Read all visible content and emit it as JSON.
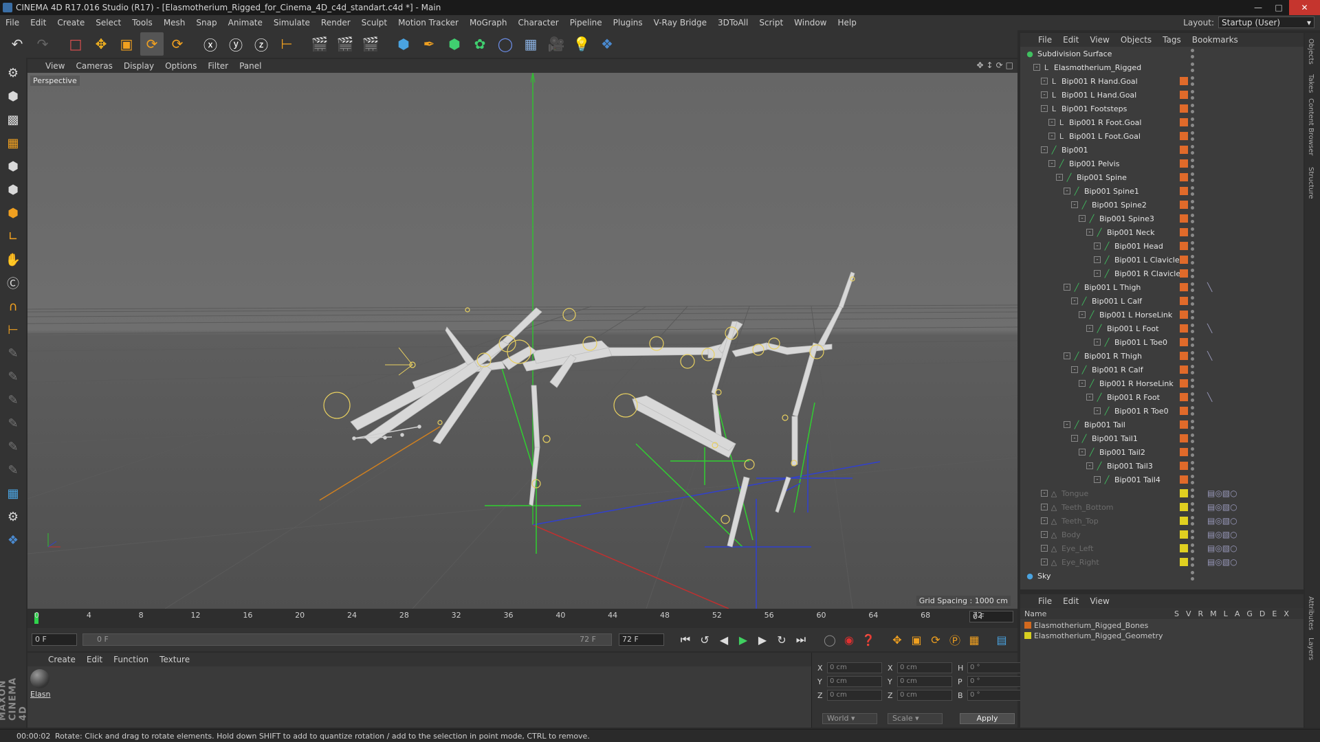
{
  "window": {
    "title": "CINEMA 4D R17.016 Studio (R17) - [Elasmotherium_Rigged_for_Cinema_4D_c4d_standart.c4d *] - Main"
  },
  "menubar": {
    "items": [
      "File",
      "Edit",
      "Create",
      "Select",
      "Tools",
      "Mesh",
      "Snap",
      "Animate",
      "Simulate",
      "Render",
      "Sculpt",
      "Motion Tracker",
      "MoGraph",
      "Character",
      "Pipeline",
      "Plugins",
      "V-Ray Bridge",
      "3DToAll",
      "Script",
      "Window",
      "Help"
    ],
    "layout_label": "Layout:",
    "layout_value": "Startup (User)"
  },
  "viewport": {
    "menu": [
      "View",
      "Cameras",
      "Display",
      "Options",
      "Filter",
      "Panel"
    ],
    "camera_label": "Perspective",
    "grid_spacing": "Grid Spacing : 1000 cm"
  },
  "timeline": {
    "ticks": [
      "0",
      "4",
      "8",
      "12",
      "16",
      "20",
      "24",
      "28",
      "32",
      "36",
      "40",
      "44",
      "48",
      "52",
      "56",
      "60",
      "64",
      "68",
      "72"
    ],
    "current_frame": "0 F"
  },
  "transport": {
    "start_field": "0 F",
    "slider_start": "0 F",
    "slider_end": "72 F",
    "end_field": "72 F"
  },
  "material_manager": {
    "menu": [
      "Create",
      "Edit",
      "Function",
      "Texture"
    ],
    "materials": [
      {
        "name": "Elasn"
      }
    ]
  },
  "coordinates": {
    "rows": [
      {
        "a": "X",
        "a_val": "0 cm",
        "b": "X",
        "b_val": "0 cm",
        "c": "H",
        "c_val": "0 °"
      },
      {
        "a": "Y",
        "a_val": "0 cm",
        "b": "Y",
        "b_val": "0 cm",
        "c": "P",
        "c_val": "0 °"
      },
      {
        "a": "Z",
        "a_val": "0 cm",
        "b": "Z",
        "b_val": "0 cm",
        "c": "B",
        "c_val": "0 °"
      }
    ],
    "mode": "World",
    "size_mode": "Scale",
    "apply_label": "Apply"
  },
  "object_manager": {
    "menu": [
      "File",
      "Edit",
      "View",
      "Objects",
      "Tags",
      "Bookmarks"
    ],
    "objects": [
      {
        "name": "Subdivision Surface",
        "depth": 0,
        "icon": "subdivision-icon",
        "dim": false,
        "tag_color": "",
        "tag": ""
      },
      {
        "name": "Elasmotherium_Rigged",
        "depth": 1,
        "icon": "null-icon",
        "dim": false,
        "tag_color": "",
        "tag": ""
      },
      {
        "name": "Bip001 R Hand.Goal",
        "depth": 2,
        "icon": "null-icon",
        "dim": false,
        "tag_color": "#e06a2a",
        "tag": ""
      },
      {
        "name": "Bip001 L Hand.Goal",
        "depth": 2,
        "icon": "null-icon",
        "dim": false,
        "tag_color": "#e06a2a",
        "tag": ""
      },
      {
        "name": "Bip001 Footsteps",
        "depth": 2,
        "icon": "null-icon",
        "dim": false,
        "tag_color": "#e06a2a",
        "tag": ""
      },
      {
        "name": "Bip001 R Foot.Goal",
        "depth": 3,
        "icon": "null-icon",
        "dim": false,
        "tag_color": "#e06a2a",
        "tag": ""
      },
      {
        "name": "Bip001 L Foot.Goal",
        "depth": 3,
        "icon": "null-icon",
        "dim": false,
        "tag_color": "#e06a2a",
        "tag": ""
      },
      {
        "name": "Bip001",
        "depth": 2,
        "icon": "joint-icon",
        "dim": false,
        "tag_color": "#e06a2a",
        "tag": ""
      },
      {
        "name": "Bip001 Pelvis",
        "depth": 3,
        "icon": "joint-icon",
        "dim": false,
        "tag_color": "#e06a2a",
        "tag": ""
      },
      {
        "name": "Bip001 Spine",
        "depth": 4,
        "icon": "joint-icon",
        "dim": false,
        "tag_color": "#e06a2a",
        "tag": ""
      },
      {
        "name": "Bip001 Spine1",
        "depth": 5,
        "icon": "joint-icon",
        "dim": false,
        "tag_color": "#e06a2a",
        "tag": ""
      },
      {
        "name": "Bip001 Spine2",
        "depth": 6,
        "icon": "joint-icon",
        "dim": false,
        "tag_color": "#e06a2a",
        "tag": ""
      },
      {
        "name": "Bip001 Spine3",
        "depth": 7,
        "icon": "joint-icon",
        "dim": false,
        "tag_color": "#e06a2a",
        "tag": ""
      },
      {
        "name": "Bip001 Neck",
        "depth": 8,
        "icon": "joint-icon",
        "dim": false,
        "tag_color": "#e06a2a",
        "tag": ""
      },
      {
        "name": "Bip001 Head",
        "depth": 9,
        "icon": "joint-icon",
        "dim": false,
        "tag_color": "#e06a2a",
        "tag": ""
      },
      {
        "name": "Bip001 L Clavicle",
        "depth": 9,
        "icon": "joint-icon",
        "dim": false,
        "tag_color": "#e06a2a",
        "tag": ""
      },
      {
        "name": "Bip001 R Clavicle",
        "depth": 9,
        "icon": "joint-icon",
        "dim": false,
        "tag_color": "#e06a2a",
        "tag": ""
      },
      {
        "name": "Bip001 L Thigh",
        "depth": 5,
        "icon": "joint-icon",
        "dim": false,
        "tag_color": "#e06a2a",
        "tag": "ik-tag-icon"
      },
      {
        "name": "Bip001 L Calf",
        "depth": 6,
        "icon": "joint-icon",
        "dim": false,
        "tag_color": "#e06a2a",
        "tag": ""
      },
      {
        "name": "Bip001 L HorseLink",
        "depth": 7,
        "icon": "joint-icon",
        "dim": false,
        "tag_color": "#e06a2a",
        "tag": ""
      },
      {
        "name": "Bip001 L Foot",
        "depth": 8,
        "icon": "joint-icon",
        "dim": false,
        "tag_color": "#e06a2a",
        "tag": "ik-goal-tag-icon"
      },
      {
        "name": "Bip001 L Toe0",
        "depth": 9,
        "icon": "joint-icon",
        "dim": false,
        "tag_color": "#e06a2a",
        "tag": ""
      },
      {
        "name": "Bip001 R Thigh",
        "depth": 5,
        "icon": "joint-icon",
        "dim": false,
        "tag_color": "#e06a2a",
        "tag": "ik-tag-icon"
      },
      {
        "name": "Bip001 R Calf",
        "depth": 6,
        "icon": "joint-icon",
        "dim": false,
        "tag_color": "#e06a2a",
        "tag": ""
      },
      {
        "name": "Bip001 R HorseLink",
        "depth": 7,
        "icon": "joint-icon",
        "dim": false,
        "tag_color": "#e06a2a",
        "tag": ""
      },
      {
        "name": "Bip001 R Foot",
        "depth": 8,
        "icon": "joint-icon",
        "dim": false,
        "tag_color": "#e06a2a",
        "tag": "ik-goal-tag-icon"
      },
      {
        "name": "Bip001 R Toe0",
        "depth": 9,
        "icon": "joint-icon",
        "dim": false,
        "tag_color": "#e06a2a",
        "tag": ""
      },
      {
        "name": "Bip001 Tail",
        "depth": 5,
        "icon": "joint-icon",
        "dim": false,
        "tag_color": "#e06a2a",
        "tag": ""
      },
      {
        "name": "Bip001 Tail1",
        "depth": 6,
        "icon": "joint-icon",
        "dim": false,
        "tag_color": "#e06a2a",
        "tag": ""
      },
      {
        "name": "Bip001 Tail2",
        "depth": 7,
        "icon": "joint-icon",
        "dim": false,
        "tag_color": "#e06a2a",
        "tag": ""
      },
      {
        "name": "Bip001 Tail3",
        "depth": 8,
        "icon": "joint-icon",
        "dim": false,
        "tag_color": "#e06a2a",
        "tag": ""
      },
      {
        "name": "Bip001 Tail4",
        "depth": 9,
        "icon": "joint-icon",
        "dim": false,
        "tag_color": "#e06a2a",
        "tag": ""
      },
      {
        "name": "Tongue",
        "depth": 2,
        "icon": "polygon-icon",
        "dim": true,
        "tag_color": "#e0d020",
        "tag": "material-tags-icon"
      },
      {
        "name": "Teeth_Bottom",
        "depth": 2,
        "icon": "polygon-icon",
        "dim": true,
        "tag_color": "#e0d020",
        "tag": "material-tags-icon"
      },
      {
        "name": "Teeth_Top",
        "depth": 2,
        "icon": "polygon-icon",
        "dim": true,
        "tag_color": "#e0d020",
        "tag": "material-tags-icon"
      },
      {
        "name": "Body",
        "depth": 2,
        "icon": "polygon-icon",
        "dim": true,
        "tag_color": "#e0d020",
        "tag": "material-tags-icon"
      },
      {
        "name": "Eye_Left",
        "depth": 2,
        "icon": "polygon-icon",
        "dim": true,
        "tag_color": "#e0d020",
        "tag": "material-tags-icon"
      },
      {
        "name": "Eye_Right",
        "depth": 2,
        "icon": "polygon-icon",
        "dim": true,
        "tag_color": "#e0d020",
        "tag": "material-tags-icon"
      },
      {
        "name": "Sky",
        "depth": 0,
        "icon": "sky-icon",
        "dim": false,
        "tag_color": "",
        "tag": ""
      }
    ]
  },
  "layer_manager": {
    "menu": [
      "File",
      "Edit",
      "View"
    ],
    "name_header": "Name",
    "column_headers": [
      "S",
      "V",
      "R",
      "M",
      "L",
      "A",
      "G",
      "D",
      "E",
      "X"
    ],
    "layers": [
      {
        "name": "Elasmotherium_Rigged_Bones",
        "color": "#d2691e"
      },
      {
        "name": "Elasmotherium_Rigged_Geometry",
        "color": "#d8d020"
      }
    ]
  },
  "right_tabs": [
    "Objects",
    "Takes",
    "Content Browser",
    "Structure",
    "Attributes",
    "Layers"
  ],
  "status": {
    "time": "00:00:02",
    "message": "Rotate: Click and drag to rotate elements. Hold down SHIFT to add to quantize rotation / add to the selection in point mode, CTRL to remove."
  },
  "colors": {
    "accent_orange": "#e06a2a",
    "playhead_green": "#2fd44c",
    "close_red": "#c5352e"
  }
}
